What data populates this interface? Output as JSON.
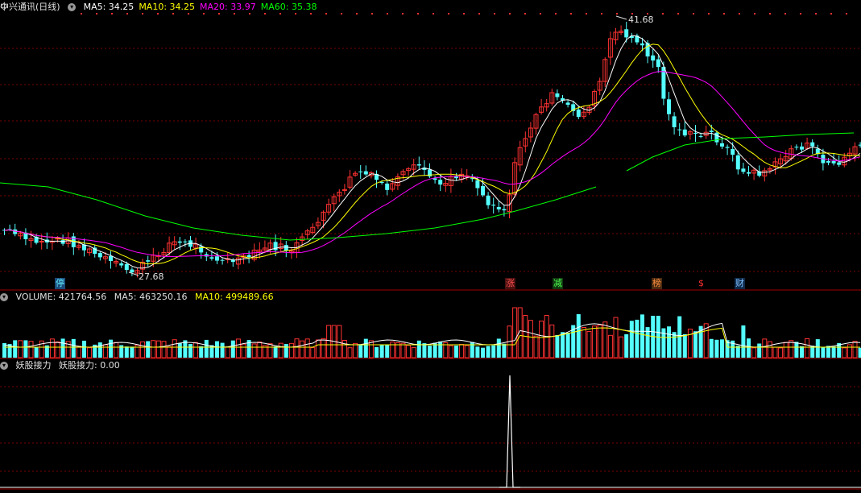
{
  "main": {
    "title": "中兴通讯(日线)",
    "ma_labels": [
      {
        "text": "MA5: 34.25",
        "color": "#ffffff"
      },
      {
        "text": "MA10: 34.25",
        "color": "#ffff00"
      },
      {
        "text": "MA20: 33.97",
        "color": "#ff00ff"
      },
      {
        "text": "MA60: 35.38",
        "color": "#00ff00"
      }
    ],
    "high_label": "41.68",
    "low_label": "27.68",
    "events": [
      {
        "text": "停",
        "color": "#5ff0ff",
        "bg": "#1a4a7a"
      },
      {
        "text": "涨",
        "color": "#ff5050",
        "bg": "#4a1010"
      },
      {
        "text": "减",
        "color": "#50ff50",
        "bg": "#0f3a0f"
      },
      {
        "text": "榜",
        "color": "#ff9040",
        "bg": "#4a2a10"
      },
      {
        "text": "$",
        "color": "#ff3030",
        "bg": "#000000"
      },
      {
        "text": "财",
        "color": "#80c0ff",
        "bg": "#0f2a4a"
      }
    ]
  },
  "volume": {
    "label": "VOLUME: 421764.56",
    "ma5": "MA5: 463250.16",
    "ma10": "MA10: 499489.66"
  },
  "indicator": {
    "label": "妖股接力",
    "value_label": "妖股接力: 0.00"
  },
  "colors": {
    "up": "#ff3232",
    "down": "#54ffff",
    "ma5": "#ffffff",
    "ma10": "#ffff00",
    "ma20": "#ff00ff",
    "ma60": "#00ff00",
    "grid": "#7a0000"
  }
}
